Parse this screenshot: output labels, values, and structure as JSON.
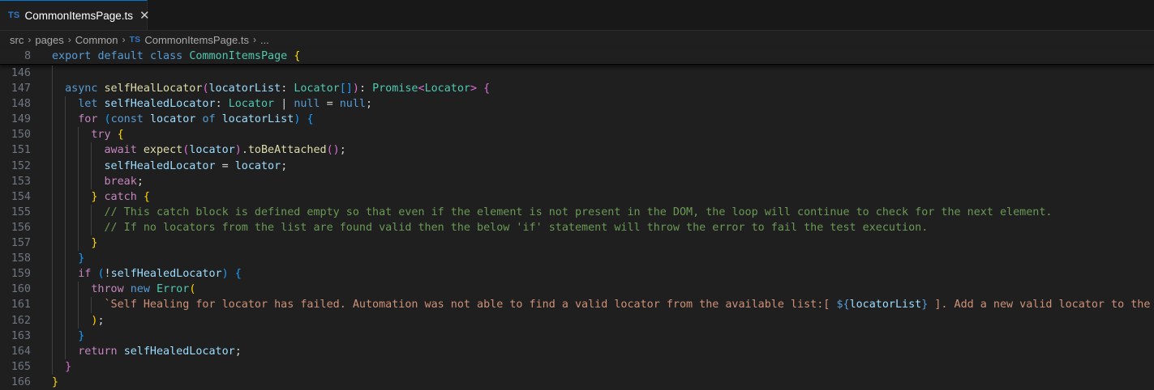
{
  "tab": {
    "icon": "TS",
    "title": "CommonItemsPage.ts",
    "close": "✕"
  },
  "breadcrumb": {
    "src": "src",
    "pages": "pages",
    "common": "Common",
    "file_icon": "TS",
    "file": "CommonItemsPage.ts",
    "more": "...",
    "separator": "›"
  },
  "sticky": {
    "ln": "8",
    "t": {
      "export": "export",
      "default": "default",
      "class": "class",
      "name": "CommonItemsPage",
      "brace": "{"
    }
  },
  "l146": {
    "ln": "146"
  },
  "l147": {
    "ln": "147",
    "t": {
      "async": "async",
      "fn": "selfHealLocator",
      "p1": "(",
      "param": "locatorList",
      "colon": ":",
      "type": "Locator",
      "arr": "[]",
      "p2": ")",
      "colon2": ":",
      "promise": "Promise",
      "lt": "<",
      "type2": "Locator",
      "gt": ">",
      "brace": "{"
    }
  },
  "l148": {
    "ln": "148",
    "t": {
      "let": "let",
      "var": "selfHealedLocator",
      "colon": ":",
      "type": "Locator",
      "pipe": "|",
      "null1": "null",
      "eq": "=",
      "null2": "null",
      "semi": ";"
    }
  },
  "l149": {
    "ln": "149",
    "t": {
      "for": "for",
      "p1": "(",
      "const": "const",
      "var": "locator",
      "of": "of",
      "list": "locatorList",
      "p2": ")",
      "brace": "{"
    }
  },
  "l150": {
    "ln": "150",
    "t": {
      "try": "try",
      "brace": "{"
    }
  },
  "l151": {
    "ln": "151",
    "t": {
      "await": "await",
      "expect": "expect",
      "p1": "(",
      "var": "locator",
      "p2": ")",
      "dot": ".",
      "method": "toBeAttached",
      "p3": "()",
      "semi": ";"
    }
  },
  "l152": {
    "ln": "152",
    "t": {
      "var": "selfHealedLocator",
      "eq": "=",
      "val": "locator",
      "semi": ";"
    }
  },
  "l153": {
    "ln": "153",
    "t": {
      "break": "break",
      "semi": ";"
    }
  },
  "l154": {
    "ln": "154",
    "t": {
      "close": "}",
      "catch": "catch",
      "brace": "{"
    }
  },
  "l155": {
    "ln": "155",
    "t": {
      "comment": "// This catch block is defined empty so that even if the element is not present in the DOM, the loop will continue to check for the next element."
    }
  },
  "l156": {
    "ln": "156",
    "t": {
      "comment": "// If no locators from the list are found valid then the below 'if' statement will throw the error to fail the test execution."
    }
  },
  "l157": {
    "ln": "157",
    "t": {
      "close": "}"
    }
  },
  "l158": {
    "ln": "158",
    "t": {
      "close": "}"
    }
  },
  "l159": {
    "ln": "159",
    "t": {
      "if": "if",
      "p1": "(",
      "not": "!",
      "var": "selfHealedLocator",
      "p2": ")",
      "brace": "{"
    }
  },
  "l160": {
    "ln": "160",
    "t": {
      "throw": "throw",
      "new": "new",
      "err": "Error",
      "p1": "("
    }
  },
  "l161": {
    "ln": "161",
    "t": {
      "str1": "`Self Healing for locator has failed. Automation was not able to find a valid locator from the available list:[ ",
      "interp_open": "${",
      "var": "locatorList",
      "interp_close": "}",
      "str2": " ]. Add a new valid locator to the list`"
    }
  },
  "l162": {
    "ln": "162",
    "t": {
      "p": ")",
      "semi": ";"
    }
  },
  "l163": {
    "ln": "163",
    "t": {
      "close": "}"
    }
  },
  "l164": {
    "ln": "164",
    "t": {
      "ret": "return",
      "var": "selfHealedLocator",
      "semi": ";"
    }
  },
  "l165": {
    "ln": "165",
    "t": {
      "close": "}"
    }
  },
  "l166": {
    "ln": "166",
    "t": {
      "close": "}"
    }
  },
  "colors": {
    "background": "#1f1f1f",
    "keyword": "#569cd6",
    "control": "#c586c0",
    "function": "#dcdcaa",
    "variable": "#9cdcfe",
    "type": "#4ec9b0",
    "string": "#ce9178",
    "comment": "#6a9955",
    "tab_accent": "#0078d4"
  }
}
